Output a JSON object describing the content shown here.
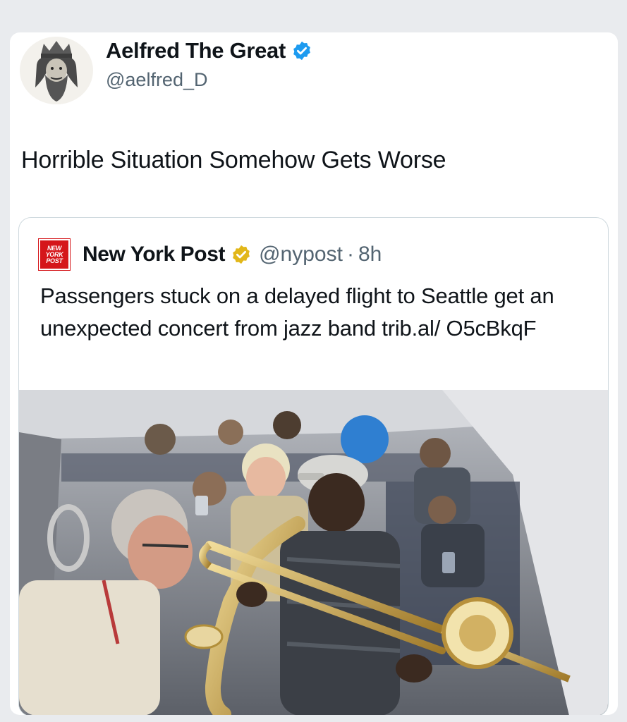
{
  "tweet": {
    "author": {
      "name": "Aelfred The Great",
      "handle": "@aelfred_D",
      "verified": true,
      "badge_color": "#1d9bf0"
    },
    "text": "Horrible Situation Somehow Gets Worse"
  },
  "quoted_tweet": {
    "source_logo_text": [
      "NEW",
      "YORK",
      "POST"
    ],
    "author_name": "New York Post",
    "badge_color": "#e2b719",
    "handle": "@nypost",
    "separator": "·",
    "time": "8h",
    "text": "Passengers stuck on a delayed flight to Seattle get an unexpected concert from jazz band trib.al/ O5cBkqF",
    "media": {
      "kind": "photo"
    }
  },
  "colors": {
    "name_text": "#0f1419",
    "secondary_text": "#536471",
    "card_border": "#cfd9de",
    "nyp_red": "#d5161a"
  }
}
